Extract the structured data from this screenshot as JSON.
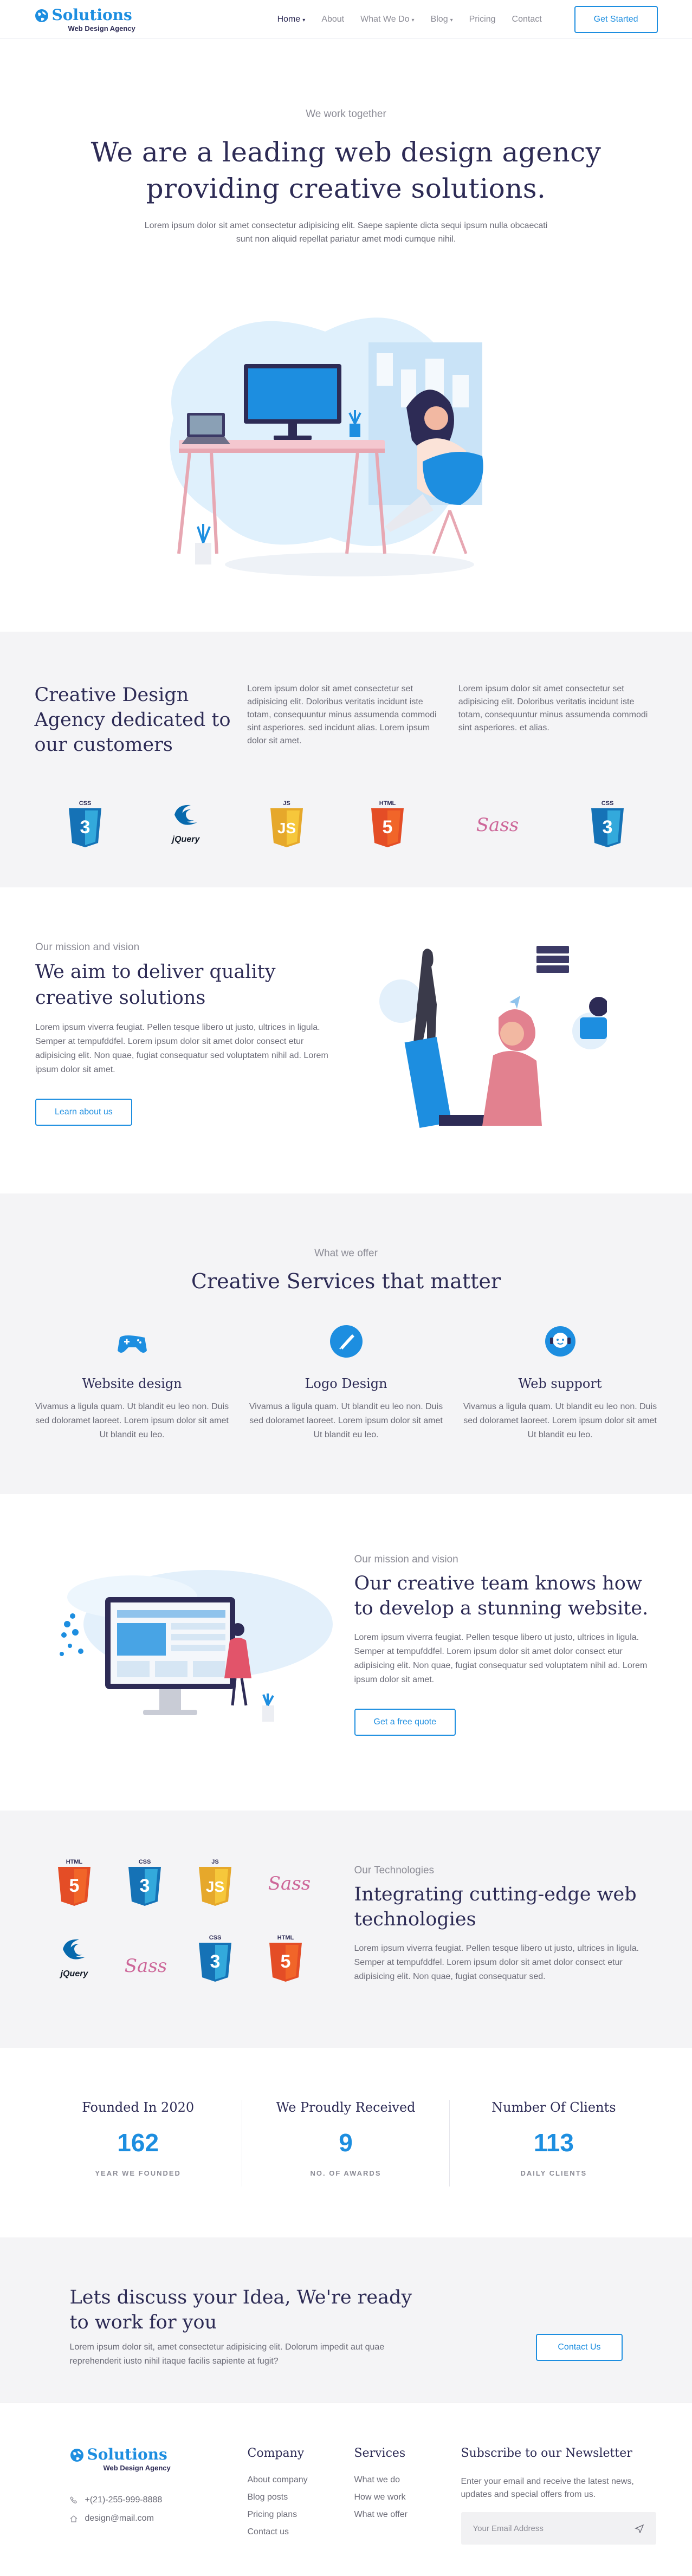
{
  "brand": {
    "name": "Solutions",
    "tagline": "Web Design Agency",
    "color": "#1d8ee0"
  },
  "nav": {
    "items": [
      {
        "label": "Home",
        "dropdown": true,
        "active": true
      },
      {
        "label": "About",
        "dropdown": false
      },
      {
        "label": "What We Do",
        "dropdown": true
      },
      {
        "label": "Blog",
        "dropdown": true
      },
      {
        "label": "Pricing",
        "dropdown": false
      },
      {
        "label": "Contact",
        "dropdown": false
      }
    ],
    "cta": "Get Started"
  },
  "hero": {
    "eyebrow": "We work together",
    "title_line1": "We are a leading web design agency",
    "title_line2": "providing creative solutions.",
    "text": "Lorem ipsum dolor sit amet consectetur adipisicing elit. Saepe sapiente dicta sequi ipsum nulla obcaecati sunt non aliquid repellat pariatur amet modi cumque nihil."
  },
  "agency": {
    "title": "Creative Design Agency dedicated to our customers",
    "col1": "Lorem ipsum dolor sit amet consectetur set adipisicing elit. Doloribus veritatis incidunt iste totam, consequuntur minus assumenda commodi sint asperiores. sed incidunt alias. Lorem ipsum dolor sit amet.",
    "col2": "Lorem ipsum dolor sit amet consectetur set adipisicing elit. Doloribus veritatis incidunt iste totam, consequuntur minus assumenda commodi sint asperiores. et alias.",
    "logos": [
      "CSS",
      "jQuery",
      "JS",
      "HTML",
      "Sass",
      "CSS"
    ]
  },
  "mission": {
    "eyebrow": "Our mission and vision",
    "title_line1": "We aim to deliver quality",
    "title_line2": "creative solutions",
    "text": "Lorem ipsum viverra feugiat. Pellen tesque libero ut justo, ultrices in ligula. Semper at tempufddfel. Lorem ipsum dolor sit amet dolor consect etur adipisicing elit. Non quae, fugiat consequatur sed voluptatem nihil ad. Lorem ipsum dolor sit amet.",
    "button": "Learn about us"
  },
  "services": {
    "eyebrow": "What we offer",
    "title": "Creative Services that matter",
    "items": [
      {
        "title": "Website design",
        "text": "Vivamus a ligula quam. Ut blandit eu leo non. Duis sed doloramet laoreet. Lorem ipsum dolor sit amet Ut blandit eu leo."
      },
      {
        "title": "Logo Design",
        "text": "Vivamus a ligula quam. Ut blandit eu leo non. Duis sed doloramet laoreet. Lorem ipsum dolor sit amet Ut blandit eu leo."
      },
      {
        "title": "Web support",
        "text": "Vivamus a ligula quam. Ut blandit eu leo non. Duis sed doloramet laoreet. Lorem ipsum dolor sit amet Ut blandit eu leo."
      }
    ]
  },
  "team": {
    "eyebrow": "Our mission and vision",
    "title_line1": "Our creative team knows how",
    "title_line2": "to develop a stunning website.",
    "text": "Lorem ipsum viverra feugiat. Pellen tesque libero ut justo, ultrices in ligula. Semper at tempufddfel. Lorem ipsum dolor sit amet dolor consect etur adipisicing elit. Non quae, fugiat consequatur sed voluptatem nihil ad. Lorem ipsum dolor sit amet.",
    "button": "Get a free quote"
  },
  "technologies": {
    "eyebrow": "Our Technologies",
    "title_line1": "Integrating cutting-edge web",
    "title_line2": "technologies",
    "text": "Lorem ipsum viverra feugiat. Pellen tesque libero ut justo, ultrices in ligula. Semper at tempufddfel. Lorem ipsum dolor sit amet dolor consect etur adipisicing elit. Non quae, fugiat consequatur sed.",
    "logos": [
      "HTML",
      "CSS",
      "JS",
      "Sass",
      "jQuery",
      "Sass",
      "CSS",
      "HTML"
    ]
  },
  "stats": [
    {
      "title": "Founded In 2020",
      "value": "162",
      "caption": "YEAR WE FOUNDED"
    },
    {
      "title": "We Proudly Received",
      "value": "9",
      "caption": "NO. OF AWARDS"
    },
    {
      "title": "Number Of Clients",
      "value": "113",
      "caption": "DAILY CLIENTS"
    }
  ],
  "cta": {
    "title_line1": "Lets discuss your Idea, We're ready",
    "title_line2": "to work for you",
    "text": "Lorem ipsum dolor sit, amet consectetur adipisicing elit. Dolorum impedit aut quae reprehenderit iusto nihil itaque facilis sapiente at fugit?",
    "button": "Contact Us"
  },
  "footer": {
    "phone": "+(21)-255-999-8888",
    "email": "design@mail.com",
    "company": {
      "title": "Company",
      "links": [
        "About company",
        "Blog posts",
        "Pricing plans",
        "Contact us"
      ]
    },
    "services": {
      "title": "Services",
      "links": [
        "What we do",
        "How we work",
        "What we offer"
      ]
    },
    "newsletter": {
      "title": "Subscribe to our Newsletter",
      "text": "Enter your email and receive the latest news, updates and special offers from us.",
      "placeholder": "Your Email Address"
    }
  }
}
